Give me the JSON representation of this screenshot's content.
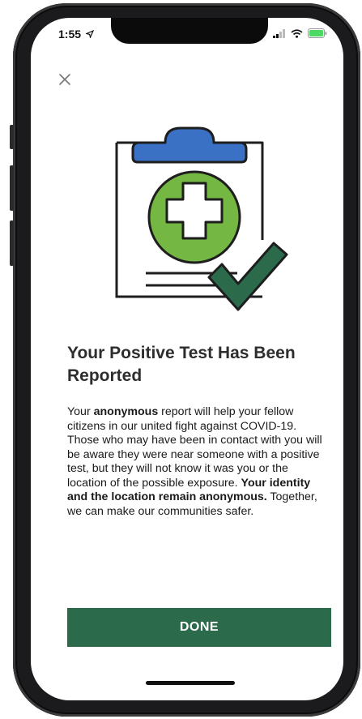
{
  "status": {
    "time": "1:55",
    "icons": [
      "location-arrow-icon",
      "signal-icon",
      "wifi-icon",
      "battery-icon"
    ],
    "battery_color": "#4cd964"
  },
  "header": {
    "close_icon": "close-icon"
  },
  "illustration": {
    "icon": "clipboard-medical-check-icon",
    "colors": {
      "clip": "#3a71c4",
      "circle": "#74b743",
      "check": "#2b6b4c"
    }
  },
  "content": {
    "title": "Your Positive Test Has Been Reported",
    "body": {
      "p1": "Your ",
      "b1": "anonymous",
      "p2": " report will help your fellow citizens in our united fight against COVID-19. Those who may have been in contact with you will be aware they were near someone with a positive test, but they will not know it was you or the location of the possible exposure. ",
      "b2": "Your identity and the location remain anonymous.",
      "p3": " Together, we can make our communities safer."
    }
  },
  "actions": {
    "done_label": "DONE",
    "done_color": "#2b6b4c"
  }
}
